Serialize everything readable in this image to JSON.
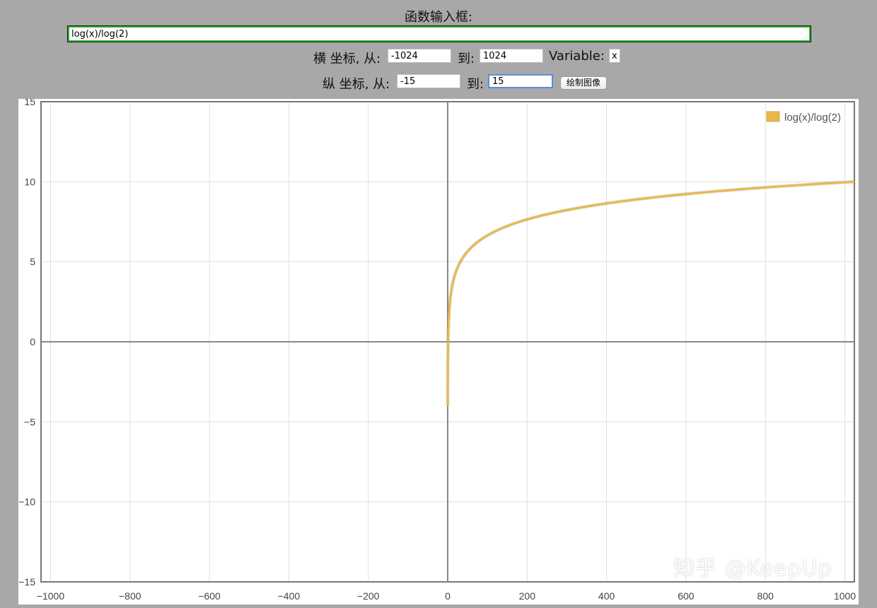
{
  "header": {
    "function_label": "函数输入框:",
    "function_value": "log(x)/log(2)"
  },
  "xrange": {
    "label": "横 坐标, 从:",
    "from": "-1024",
    "to_label": "到:",
    "to": "1024",
    "variable_label": "Variable:",
    "variable": "x"
  },
  "yrange": {
    "label": "纵 坐标, 从:",
    "from": "-15",
    "to_label": "到:",
    "to": "15",
    "plot_button": "绘制图像"
  },
  "watermark": "知乎 @KeepUp",
  "colors": {
    "curve": "#e8b94a",
    "axis": "#888888",
    "grid": "#e0e0e0",
    "input_border": "#2fb52f"
  },
  "chart_data": {
    "type": "line",
    "title": "",
    "xlabel": "",
    "ylabel": "",
    "xlim": [
      -1024,
      1024
    ],
    "ylim": [
      -15,
      15
    ],
    "x_ticks": [
      -1000,
      -800,
      -600,
      -400,
      -200,
      0,
      200,
      400,
      600,
      800,
      1000
    ],
    "y_ticks": [
      15,
      10,
      5,
      0,
      -5,
      -10,
      -15
    ],
    "x_tick_labels": [
      "−1000",
      "−800",
      "−600",
      "−400",
      "−200",
      "0",
      "200",
      "400",
      "600",
      "800",
      "1000"
    ],
    "y_tick_labels": [
      "15",
      "10",
      "5",
      "0",
      "−5",
      "−10",
      "−15"
    ],
    "grid": true,
    "legend_position": "top-right",
    "series": [
      {
        "name": "log(x)/log(2)",
        "color": "#e8b94a",
        "x": [
          0.0625,
          0.125,
          0.25,
          0.5,
          1,
          2,
          4,
          8,
          16,
          32,
          64,
          128,
          256,
          512,
          1024
        ],
        "y": [
          -4,
          -3,
          -2,
          -1,
          0,
          1,
          2,
          3,
          4,
          5,
          6,
          7,
          8,
          9,
          10
        ]
      }
    ]
  }
}
